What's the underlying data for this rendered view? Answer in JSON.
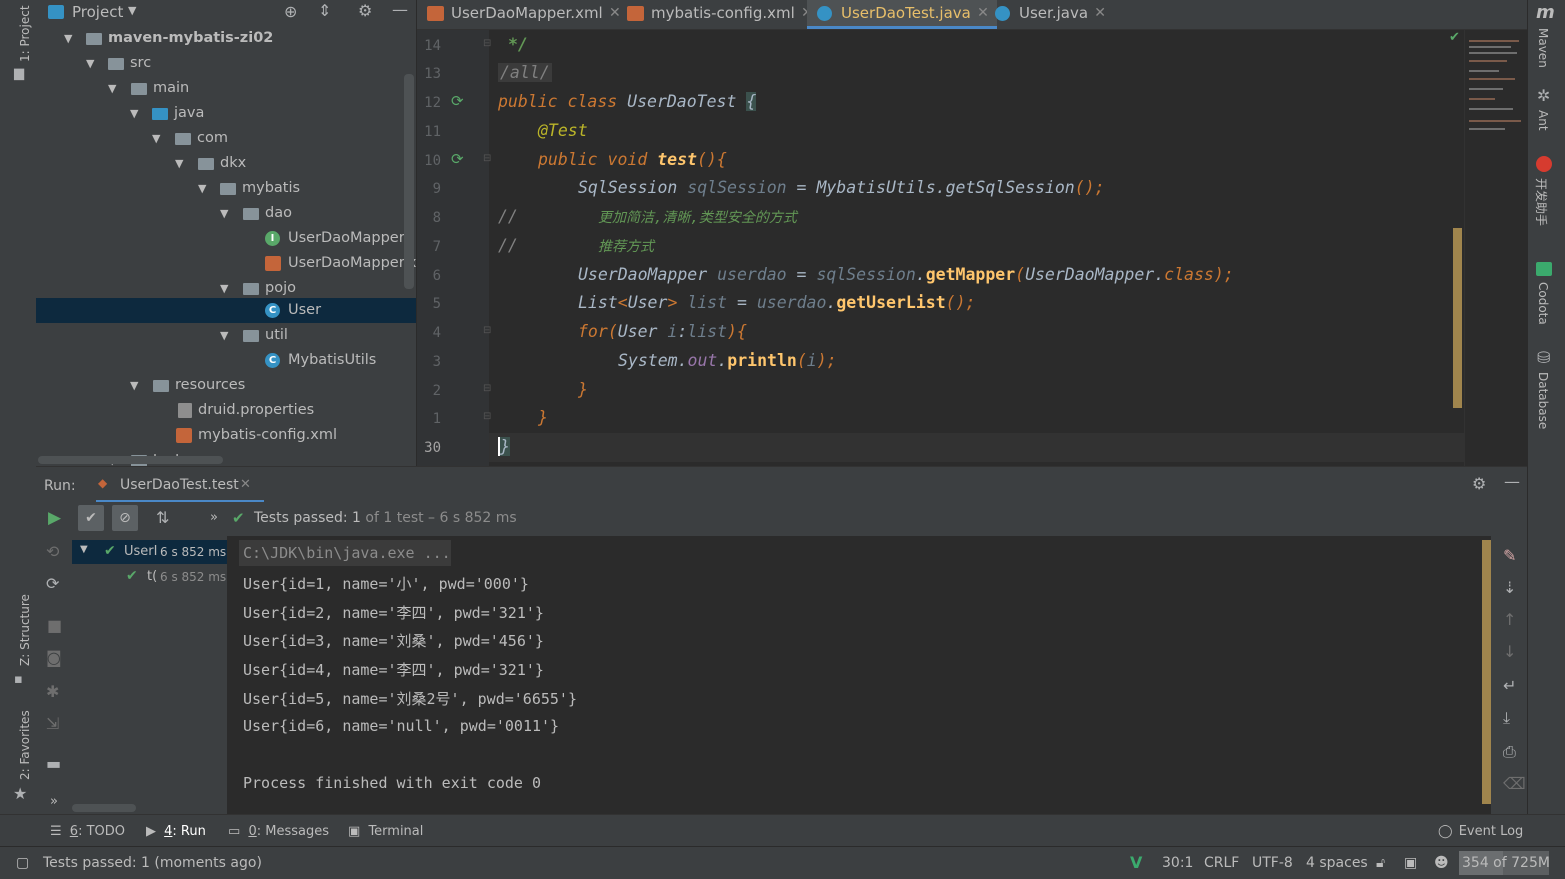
{
  "project_panel": {
    "title": "Project",
    "tree": [
      {
        "label": "maven-mybatis-zi02",
        "kind": "module"
      },
      {
        "label": "src",
        "kind": "folder"
      },
      {
        "label": "main",
        "kind": "folder"
      },
      {
        "label": "java",
        "kind": "folder-blue"
      },
      {
        "label": "com",
        "kind": "package"
      },
      {
        "label": "dkx",
        "kind": "package"
      },
      {
        "label": "mybatis",
        "kind": "package"
      },
      {
        "label": "dao",
        "kind": "package"
      },
      {
        "label": "UserDaoMapper",
        "kind": "interface"
      },
      {
        "label": "UserDaoMapper.xm",
        "kind": "xml"
      },
      {
        "label": "pojo",
        "kind": "package"
      },
      {
        "label": "User",
        "kind": "class",
        "selected": true
      },
      {
        "label": "util",
        "kind": "package"
      },
      {
        "label": "MybatisUtils",
        "kind": "class"
      },
      {
        "label": "resources",
        "kind": "folder"
      },
      {
        "label": "druid.properties",
        "kind": "properties"
      },
      {
        "label": "mybatis-config.xml",
        "kind": "xml"
      },
      {
        "label": "test",
        "kind": "folder"
      }
    ]
  },
  "left_strip": {
    "project": "1: Project",
    "structure": "Z: Structure",
    "favorites": "2: Favorites"
  },
  "editor_tabs": [
    {
      "label": "UserDaoMapper.xml",
      "icon": "xml-icon"
    },
    {
      "label": "mybatis-config.xml",
      "icon": "xml-icon"
    },
    {
      "label": "UserDaoTest.java",
      "icon": "class-icon",
      "active": true
    },
    {
      "label": "User.java",
      "icon": "class-icon"
    }
  ],
  "editor": {
    "line_numbers": [
      "14",
      "13",
      "12",
      "11",
      "10",
      "9",
      "8",
      "7",
      "6",
      "5",
      "4",
      "3",
      "2",
      "1",
      "30"
    ],
    "lines": {
      "l0": "*/",
      "l1": "/all/",
      "l2a": "public class ",
      "l2b": "UserDaoTest ",
      "l2c": "{",
      "l3": "@Test",
      "l4a": "public void ",
      "l4b": "test",
      "l4c": "(){",
      "l5a": "SqlSession ",
      "l5b": "sqlSession",
      "l5c": " = ",
      "l5d": "MybatisUtils",
      "l5e": ".",
      "l5f": "getSqlSession",
      "l5g": "();",
      "l6a": "//",
      "l6b": "更加简洁,清晰,类型安全的方式",
      "l7a": "//",
      "l7b": "推荐方式",
      "l8a": "UserDaoMapper ",
      "l8b": "userdao",
      "l8c": " = ",
      "l8d": "sqlSession",
      "l8e": ".",
      "l8f": "getMapper",
      "l8g": "(",
      "l8h": "UserDaoMapper",
      "l8i": ".",
      "l8j": "class",
      "l8k": ");",
      "l9a": "List",
      "l9b": "<",
      "l9c": "User",
      "l9d": "> ",
      "l9e": "list",
      "l9f": " = ",
      "l9g": "userdao",
      "l9h": ".",
      "l9i": "getUserList",
      "l9j": "();",
      "l10a": "for",
      "l10b": "(",
      "l10c": "User ",
      "l10d": "i",
      "l10e": ":",
      "l10f": "list",
      "l10g": "){",
      "l11a": "System",
      "l11b": ".",
      "l11c": "out",
      "l11d": ".",
      "l11e": "println",
      "l11f": "(",
      "l11g": "i",
      "l11h": ");",
      "l12": "}",
      "l13": "}",
      "l14": "}"
    }
  },
  "run_panel": {
    "label": "Run:",
    "tab": "UserDaoTest.test",
    "status_prefix": "Tests passed: ",
    "status_count": "1",
    "status_suffix": " of 1 test – 6 s 852 ms",
    "tree": [
      {
        "label": "UserI",
        "time": "6 s 852 ms"
      },
      {
        "label": "t(",
        "time": "6 s 852 ms"
      }
    ],
    "console": [
      "C:\\JDK\\bin\\java.exe ...",
      "User{id=1, name='小', pwd='000'}",
      "User{id=2, name='李四', pwd='321'}",
      "User{id=3, name='刘桑', pwd='456'}",
      "User{id=4, name='李四', pwd='321'}",
      "User{id=5, name='刘桑2号', pwd='6655'}",
      "User{id=6, name='null', pwd='0011'}",
      "",
      "Process finished with exit code 0"
    ]
  },
  "bottom_tools": {
    "todo_num": "6",
    "todo": ": TODO",
    "run_num": "4",
    "run": ": Run",
    "messages_num": "0",
    "messages": ": Messages",
    "terminal": "Terminal",
    "event_log": "Event Log"
  },
  "status_bar": {
    "message": "Tests passed: 1 (moments ago)",
    "position": "30:1",
    "line_sep": "CRLF",
    "encoding": "UTF-8",
    "indent": "4 spaces",
    "memory_used": "354",
    "memory_of": " of 725M"
  },
  "right_strip": {
    "maven": "Maven",
    "ant": "Ant",
    "helper": "开发助手",
    "codota": "Codota",
    "database": "Database",
    "m_logo": "m"
  },
  "colors": {
    "accent": "#4A88C7",
    "pass_green": "#59A869",
    "active_tab_text": "#E8BF6A"
  }
}
